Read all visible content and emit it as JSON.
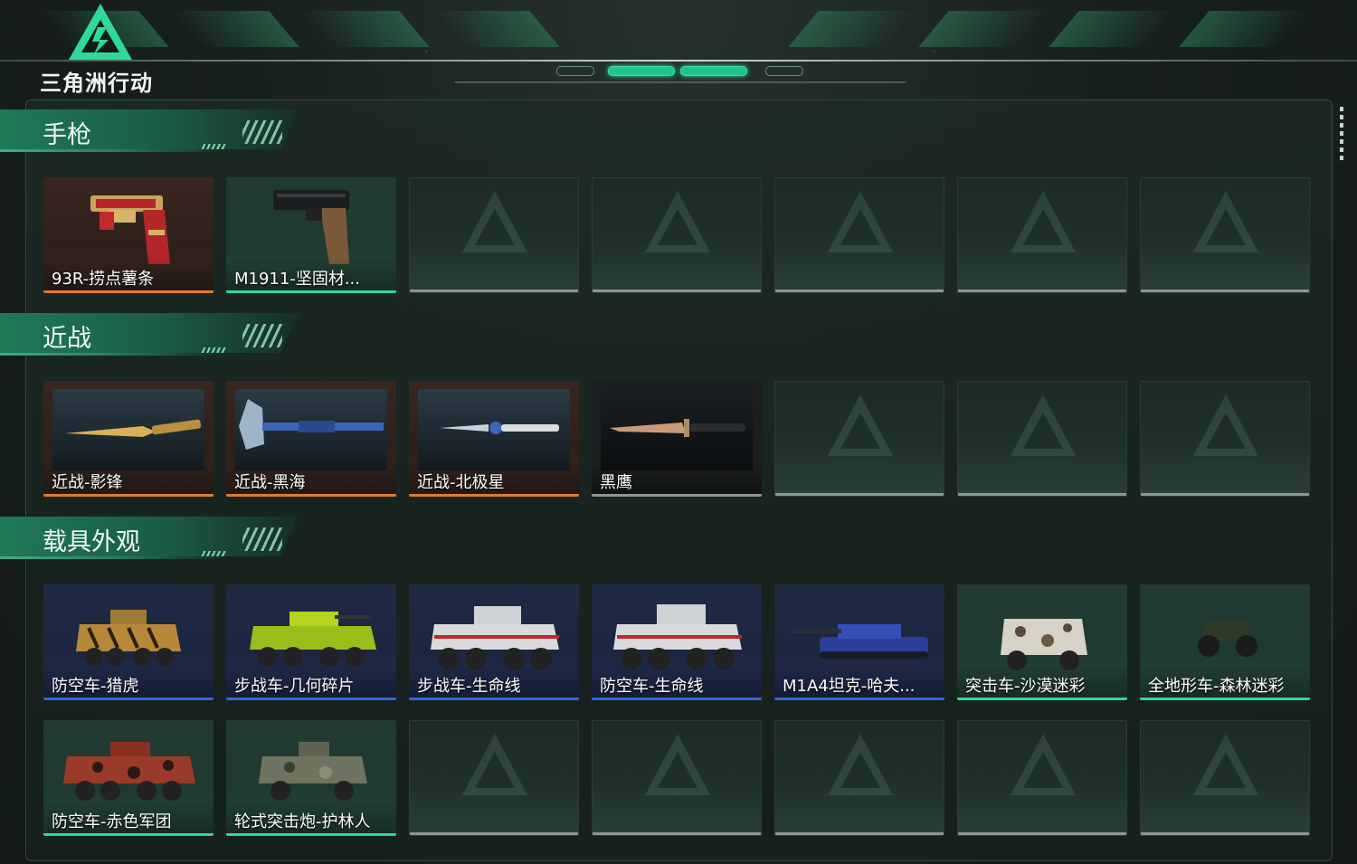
{
  "app": {
    "logo_text": "三角洲行动"
  },
  "colors": {
    "accent": "#21c48c",
    "orange": "#e07a2c",
    "green": "#2fd99a",
    "blue": "#3466d8",
    "empty": "#8c9692"
  },
  "sections": [
    {
      "title": "手枪",
      "rows": [
        [
          {
            "label": "93R-捞点薯条",
            "rarity": "orange",
            "icon": "pistol-gold-red-icon"
          },
          {
            "label": "M1911-坚固材...",
            "rarity": "green",
            "icon": "pistol-black-icon"
          },
          {
            "empty": true
          },
          {
            "empty": true
          },
          {
            "empty": true
          },
          {
            "empty": true
          },
          {
            "empty": true
          }
        ]
      ]
    },
    {
      "title": "近战",
      "rows": [
        [
          {
            "label": "近战-影锋",
            "rarity": "orange",
            "icon": "knife-gold-icon"
          },
          {
            "label": "近战-黑海",
            "rarity": "orange",
            "icon": "axe-blue-icon"
          },
          {
            "label": "近战-北极星",
            "rarity": "orange",
            "icon": "dagger-blue-icon"
          },
          {
            "label": "黑鹰",
            "rarity": "empty",
            "icon": "knife-desert-icon"
          },
          {
            "empty": true
          },
          {
            "empty": true
          },
          {
            "empty": true
          }
        ]
      ]
    },
    {
      "title": "载具外观",
      "rows": [
        [
          {
            "label": "防空车-猎虎",
            "rarity": "blue",
            "icon": "apc-tiger-icon"
          },
          {
            "label": "步战车-几何碎片",
            "rarity": "blue",
            "icon": "apc-yellow-icon"
          },
          {
            "label": "步战车-生命线",
            "rarity": "blue",
            "icon": "apc-white-icon"
          },
          {
            "label": "防空车-生命线",
            "rarity": "blue",
            "icon": "apc-white-aa-icon"
          },
          {
            "label": "M1A4坦克-哈夫...",
            "rarity": "blue",
            "icon": "tank-blue-icon"
          },
          {
            "label": "突击车-沙漠迷彩",
            "rarity": "green",
            "icon": "assault-car-desert-icon"
          },
          {
            "label": "全地形车-森林迷彩",
            "rarity": "green",
            "icon": "atv-forest-icon"
          }
        ],
        [
          {
            "label": "防空车-赤色军团",
            "rarity": "green",
            "icon": "apc-red-icon"
          },
          {
            "label": "轮式突击炮-护林人",
            "rarity": "green",
            "icon": "wheeled-gun-camo-icon"
          },
          {
            "empty": true
          },
          {
            "empty": true
          },
          {
            "empty": true
          },
          {
            "empty": true
          },
          {
            "empty": true
          }
        ]
      ]
    }
  ]
}
